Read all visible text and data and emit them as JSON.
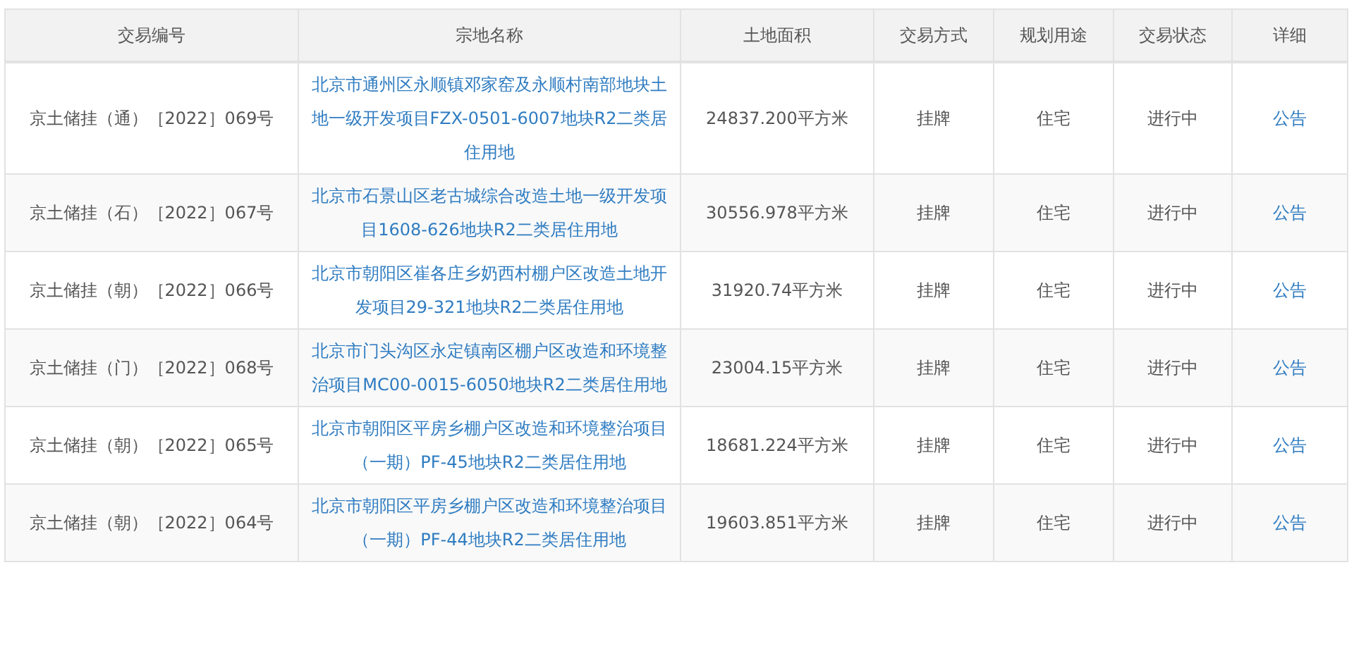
{
  "table": {
    "columns": [
      "交易编号",
      "宗地名称",
      "土地面积",
      "交易方式",
      "规划用途",
      "交易状态",
      "详细"
    ],
    "rows": [
      {
        "code": "京土储挂（通）［2022］069号",
        "name": "北京市通州区永顺镇邓家窑及永顺村南部地块土地一级开发项目FZX-0501-6007地块R2二类居住用地",
        "area": "24837.200平方米",
        "method": "挂牌",
        "use": "住宅",
        "status": "进行中",
        "detail": "公告"
      },
      {
        "code": "京土储挂（石）［2022］067号",
        "name": "北京市石景山区老古城综合改造土地一级开发项目1608-626地块R2二类居住用地",
        "area": "30556.978平方米",
        "method": "挂牌",
        "use": "住宅",
        "status": "进行中",
        "detail": "公告"
      },
      {
        "code": "京土储挂（朝）［2022］066号",
        "name": "北京市朝阳区崔各庄乡奶西村棚户区改造土地开发项目29-321地块R2二类居住用地",
        "area": "31920.74平方米",
        "method": "挂牌",
        "use": "住宅",
        "status": "进行中",
        "detail": "公告"
      },
      {
        "code": "京土储挂（门）［2022］068号",
        "name": "北京市门头沟区永定镇南区棚户区改造和环境整治项目MC00-0015-6050地块R2二类居住用地",
        "area": "23004.15平方米",
        "method": "挂牌",
        "use": "住宅",
        "status": "进行中",
        "detail": "公告"
      },
      {
        "code": "京土储挂（朝）［2022］065号",
        "name": "北京市朝阳区平房乡棚户区改造和环境整治项目（一期）PF-45地块R2二类居住用地",
        "area": "18681.224平方米",
        "method": "挂牌",
        "use": "住宅",
        "status": "进行中",
        "detail": "公告"
      },
      {
        "code": "京土储挂（朝）［2022］064号",
        "name": "北京市朝阳区平房乡棚户区改造和环境整治项目（一期）PF-44地块R2二类居住用地",
        "area": "19603.851平方米",
        "method": "挂牌",
        "use": "住宅",
        "status": "进行中",
        "detail": "公告"
      }
    ]
  }
}
